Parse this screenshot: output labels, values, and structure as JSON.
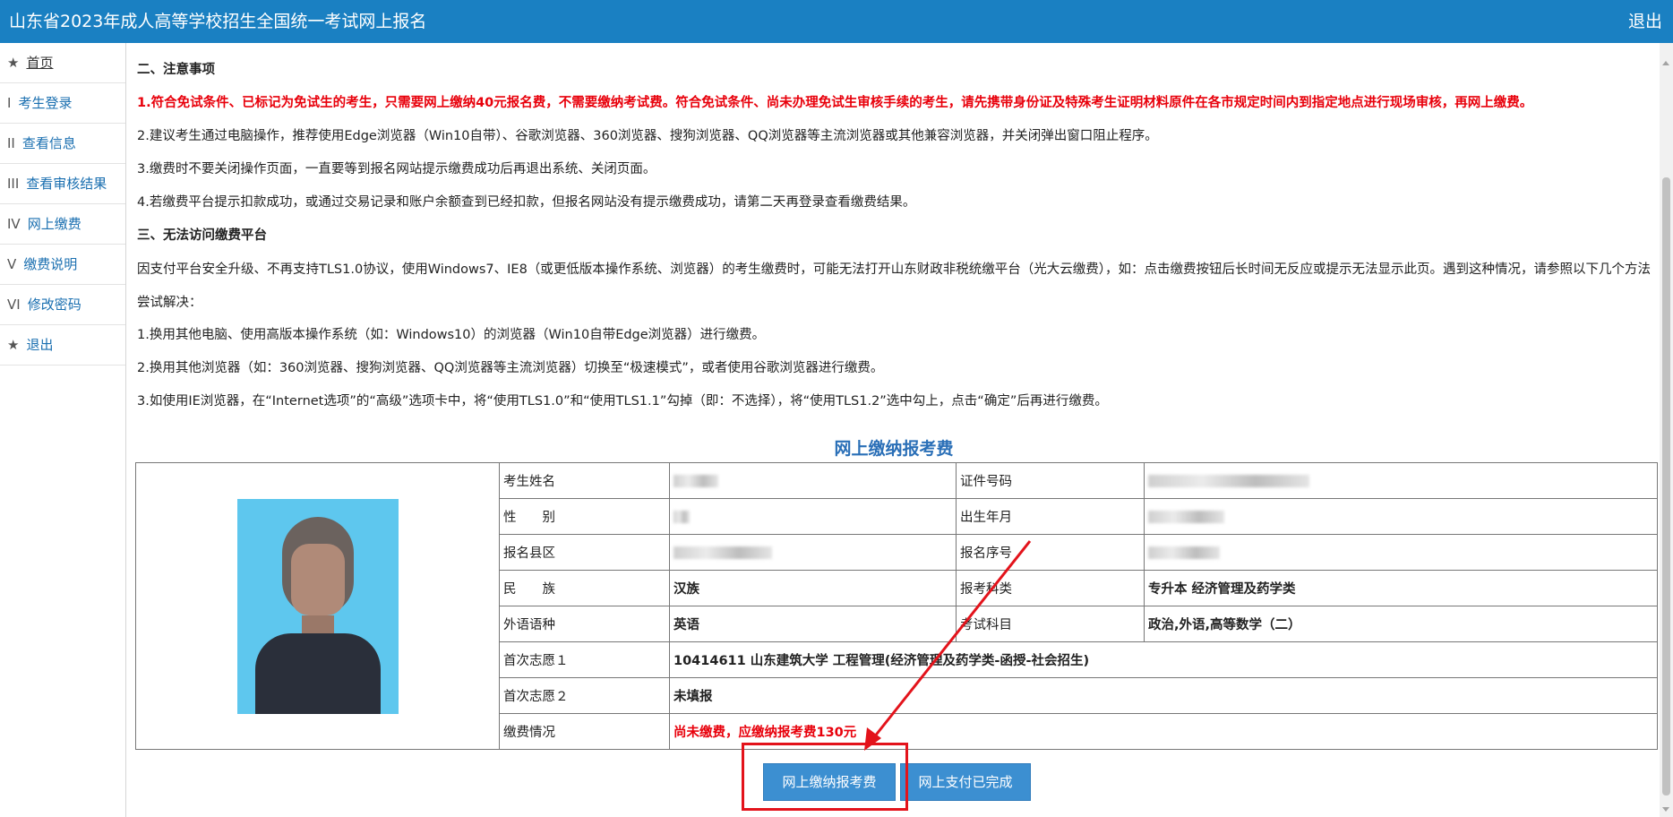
{
  "header": {
    "title": "山东省2023年成人高等学校招生全国统一考试网上报名",
    "logout_label": "退出"
  },
  "sidebar": {
    "items": [
      {
        "mark": "★",
        "label": "首页"
      },
      {
        "mark": "I",
        "label": "考生登录"
      },
      {
        "mark": "II",
        "label": "查看信息"
      },
      {
        "mark": "III",
        "label": "查看审核结果"
      },
      {
        "mark": "IV",
        "label": "网上缴费"
      },
      {
        "mark": "V",
        "label": "缴费说明"
      },
      {
        "mark": "VI",
        "label": "修改密码"
      },
      {
        "mark": "★",
        "label": "退出"
      }
    ]
  },
  "notice": {
    "heading2": "二、注意事项",
    "item1": "1.符合免试条件、已标记为免试生的考生，只需要网上缴纳40元报名费，不需要缴纳考试费。符合免试条件、尚未办理免试生审核手续的考生，请先携带身份证及特殊考生证明材料原件在各市规定时间内到指定地点进行现场审核，再网上缴费。",
    "item2": "2.建议考生通过电脑操作，推荐使用Edge浏览器（Win10自带）、谷歌浏览器、360浏览器、搜狗浏览器、QQ浏览器等主流浏览器或其他兼容浏览器，并关闭弹出窗口阻止程序。",
    "item3": "3.缴费时不要关闭操作页面，一直要等到报名网站提示缴费成功后再退出系统、关闭页面。",
    "item4": "4.若缴费平台提示扣款成功，或通过交易记录和账户余额查到已经扣款，但报名网站没有提示缴费成功，请第二天再登录查看缴费结果。",
    "heading3": "三、无法访问缴费平台",
    "para": "因支付平台安全升级、不再支持TLS1.0协议，使用Windows7、IE8（或更低版本操作系统、浏览器）的考生缴费时，可能无法打开山东财政非税统缴平台（光大云缴费），如：点击缴费按钮后长时间无反应或提示无法显示此页。遇到这种情况，请参照以下几个方法尝试解决：",
    "sol1": "1.换用其他电脑、使用高版本操作系统（如：Windows10）的浏览器（Win10自带Edge浏览器）进行缴费。",
    "sol2": "2.换用其他浏览器（如：360浏览器、搜狗浏览器、QQ浏览器等主流浏览器）切换至“极速模式”，或者使用谷歌浏览器进行缴费。",
    "sol3": "3.如使用IE浏览器，在“Internet选项”的“高级”选项卡中，将“使用TLS1.0”和“使用TLS1.1”勾掉（即：不选择），将“使用TLS1.2”选中勾上，点击“确定”后再进行缴费。"
  },
  "payment": {
    "section_title": "网上缴纳报考费",
    "labels": {
      "name": "考生姓名",
      "id_no": "证件号码",
      "gender": "性　　别",
      "birth": "出生年月",
      "county": "报名县区",
      "serial": "报名序号",
      "ethnicity": "民　　族",
      "category": "报考科类",
      "language": "外语语种",
      "subjects": "考试科目",
      "choice1": "首次志愿１",
      "choice2": "首次志愿２",
      "pay_status": "缴费情况"
    },
    "values": {
      "ethnicity": "汉族",
      "category": "专升本 经济管理及药学类",
      "language": "英语",
      "subjects": "政治,外语,高等数学（二）",
      "choice1": "10414611 山东建筑大学 工程管理(经济管理及药学类-函授-社会招生)",
      "choice2": "未填报",
      "pay_status": "尚未缴费，应缴纳报考费130元"
    },
    "pay_button": "网上缴纳报考费",
    "done_button": "网上支付已完成"
  },
  "colors": {
    "header_bg": "#1a80c2",
    "notice_red": "#e8000b",
    "section_blue": "#2a6fb7",
    "button_blue": "#3c8fd1",
    "annotation_red": "#e3131b"
  }
}
